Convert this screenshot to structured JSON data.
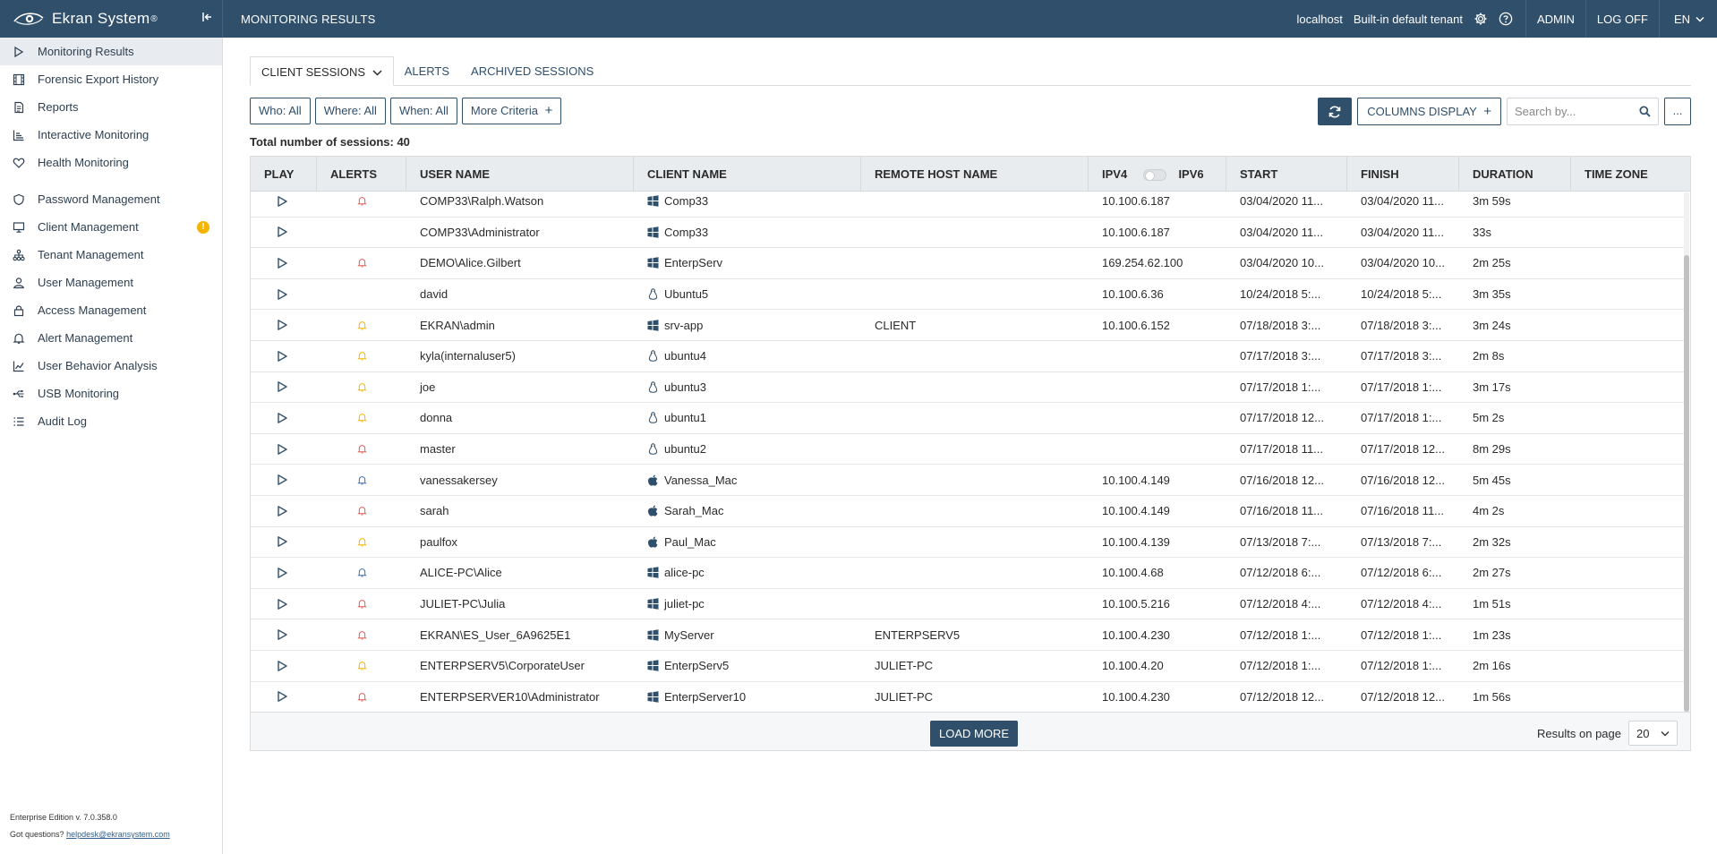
{
  "app": {
    "brand": "Ekran System",
    "page_heading": "MONITORING RESULTS",
    "server": "localhost",
    "tenant": "Built-in default tenant",
    "admin_label": "ADMIN",
    "logoff_label": "LOG OFF",
    "language": "EN"
  },
  "sidebar": {
    "items": [
      {
        "label": "Monitoring Results",
        "icon": "play-icon"
      },
      {
        "label": "Forensic Export History",
        "icon": "film-icon"
      },
      {
        "label": "Reports",
        "icon": "document-icon"
      },
      {
        "label": "Interactive Monitoring",
        "icon": "bars-icon"
      },
      {
        "label": "Health Monitoring",
        "icon": "heart-icon"
      },
      {
        "label": "Password Management",
        "icon": "shield-icon"
      },
      {
        "label": "Client Management",
        "icon": "monitor-icon",
        "badge": "!"
      },
      {
        "label": "Tenant Management",
        "icon": "hierarchy-icon"
      },
      {
        "label": "User Management",
        "icon": "user-icon"
      },
      {
        "label": "Access Management",
        "icon": "lock-icon"
      },
      {
        "label": "Alert Management",
        "icon": "bell-icon"
      },
      {
        "label": "User Behavior Analysis",
        "icon": "chart-line-icon"
      },
      {
        "label": "USB Monitoring",
        "icon": "usb-icon"
      },
      {
        "label": "Audit Log",
        "icon": "list-icon"
      }
    ],
    "footer_edition": "Enterprise Edition v. 7.0.358.0",
    "footer_questions": "Got questions?",
    "footer_email": "helpdesk@ekransystem.com"
  },
  "tabs": [
    {
      "label": "CLIENT SESSIONS",
      "active": true
    },
    {
      "label": "ALERTS",
      "active": false
    },
    {
      "label": "ARCHIVED SESSIONS",
      "active": false
    }
  ],
  "filters": {
    "who": "Who: All",
    "where": "Where: All",
    "when": "When: All",
    "more": "More Criteria"
  },
  "controls": {
    "columns_display": "COLUMNS DISPLAY",
    "search_placeholder": "Search by...",
    "more": "..."
  },
  "total_label": "Total number of sessions: 40",
  "table": {
    "columns": [
      "PLAY",
      "ALERTS",
      "USER NAME",
      "CLIENT NAME",
      "REMOTE HOST NAME",
      "IPV4",
      "IPV6",
      "START",
      "FINISH",
      "DURATION",
      "TIME ZONE"
    ],
    "rows": [
      {
        "alert": "red",
        "user": "COMP33\\Ralph.Watson",
        "os": "windows",
        "client": "Comp33",
        "remote": "",
        "ip": "10.100.6.187",
        "start": "03/04/2020 11...",
        "finish": "03/04/2020 11...",
        "duration": "3m 59s"
      },
      {
        "alert": "",
        "user": "COMP33\\Administrator",
        "os": "windows",
        "client": "Comp33",
        "remote": "",
        "ip": "10.100.6.187",
        "start": "03/04/2020 11...",
        "finish": "03/04/2020 11...",
        "duration": "33s"
      },
      {
        "alert": "red",
        "user": "DEMO\\Alice.Gilbert",
        "os": "windows",
        "client": "EnterpServ",
        "remote": "",
        "ip": "169.254.62.100",
        "start": "03/04/2020 10...",
        "finish": "03/04/2020 10...",
        "duration": "2m 25s"
      },
      {
        "alert": "",
        "user": "david",
        "os": "linux",
        "client": "Ubuntu5",
        "remote": "",
        "ip": "10.100.6.36",
        "start": "10/24/2018 5:...",
        "finish": "10/24/2018 5:...",
        "duration": "3m 35s"
      },
      {
        "alert": "yellow",
        "user": "EKRAN\\admin",
        "os": "windows",
        "client": "srv-app",
        "remote": "CLIENT",
        "ip": "10.100.6.152",
        "start": "07/18/2018 3:...",
        "finish": "07/18/2018 3:...",
        "duration": "3m 24s"
      },
      {
        "alert": "yellow",
        "user": "kyla(internaluser5)",
        "os": "linux",
        "client": "ubuntu4",
        "remote": "",
        "ip": "",
        "start": "07/17/2018 3:...",
        "finish": "07/17/2018 3:...",
        "duration": "2m 8s"
      },
      {
        "alert": "yellow",
        "user": "joe",
        "os": "linux",
        "client": "ubuntu3",
        "remote": "",
        "ip": "",
        "start": "07/17/2018 1:...",
        "finish": "07/17/2018 1:...",
        "duration": "3m 17s"
      },
      {
        "alert": "yellow",
        "user": "donna",
        "os": "linux",
        "client": "ubuntu1",
        "remote": "",
        "ip": "",
        "start": "07/17/2018 12...",
        "finish": "07/17/2018 1:...",
        "duration": "5m 2s"
      },
      {
        "alert": "red",
        "user": "master",
        "os": "linux",
        "client": "ubuntu2",
        "remote": "",
        "ip": "",
        "start": "07/17/2018 11...",
        "finish": "07/17/2018 12...",
        "duration": "8m 29s"
      },
      {
        "alert": "blue",
        "user": "vanessakersey",
        "os": "apple",
        "client": "Vanessa_Mac",
        "remote": "",
        "ip": "10.100.4.149",
        "start": "07/16/2018 12...",
        "finish": "07/16/2018 12...",
        "duration": "5m 45s"
      },
      {
        "alert": "red",
        "user": "sarah",
        "os": "apple",
        "client": "Sarah_Mac",
        "remote": "",
        "ip": "10.100.4.149",
        "start": "07/16/2018 11...",
        "finish": "07/16/2018 11...",
        "duration": "4m 2s"
      },
      {
        "alert": "yellow",
        "user": "paulfox",
        "os": "apple",
        "client": "Paul_Mac",
        "remote": "",
        "ip": "10.100.4.139",
        "start": "07/13/2018 7:...",
        "finish": "07/13/2018 7:...",
        "duration": "2m 32s"
      },
      {
        "alert": "blue",
        "user": "ALICE-PC\\Alice",
        "os": "windows",
        "client": "alice-pc",
        "remote": "",
        "ip": "10.100.4.68",
        "start": "07/12/2018 6:...",
        "finish": "07/12/2018 6:...",
        "duration": "2m 27s"
      },
      {
        "alert": "red",
        "user": "JULIET-PC\\Julia",
        "os": "windows",
        "client": "juliet-pc",
        "remote": "",
        "ip": "10.100.5.216",
        "start": "07/12/2018 4:...",
        "finish": "07/12/2018 4:...",
        "duration": "1m 51s"
      },
      {
        "alert": "red",
        "user": "EKRAN\\ES_User_6A9625E1",
        "os": "windows",
        "client": "MyServer",
        "remote": "ENTERPSERV5",
        "ip": "10.100.4.230",
        "start": "07/12/2018 1:...",
        "finish": "07/12/2018 1:...",
        "duration": "1m 23s"
      },
      {
        "alert": "yellow",
        "user": "ENTERPSERV5\\CorporateUser",
        "os": "windows",
        "client": "EnterpServ5",
        "remote": "JULIET-PC",
        "ip": "10.100.4.20",
        "start": "07/12/2018 1:...",
        "finish": "07/12/2018 1:...",
        "duration": "2m 16s"
      },
      {
        "alert": "red",
        "user": "ENTERPSERVER10\\Administrator",
        "os": "windows",
        "client": "EnterpServer10",
        "remote": "JULIET-PC",
        "ip": "10.100.4.230",
        "start": "07/12/2018 12...",
        "finish": "07/12/2018 12...",
        "duration": "1m 56s"
      }
    ]
  },
  "footer": {
    "load_more": "LOAD MORE",
    "results_on_page_label": "Results on page",
    "results_on_page_value": "20"
  },
  "colors": {
    "primary": "#2f4f6b",
    "alert_red": "#e05a5a",
    "alert_yellow": "#f2b705",
    "alert_blue": "#3d6fa8",
    "badge_warning": "#f4b400"
  }
}
